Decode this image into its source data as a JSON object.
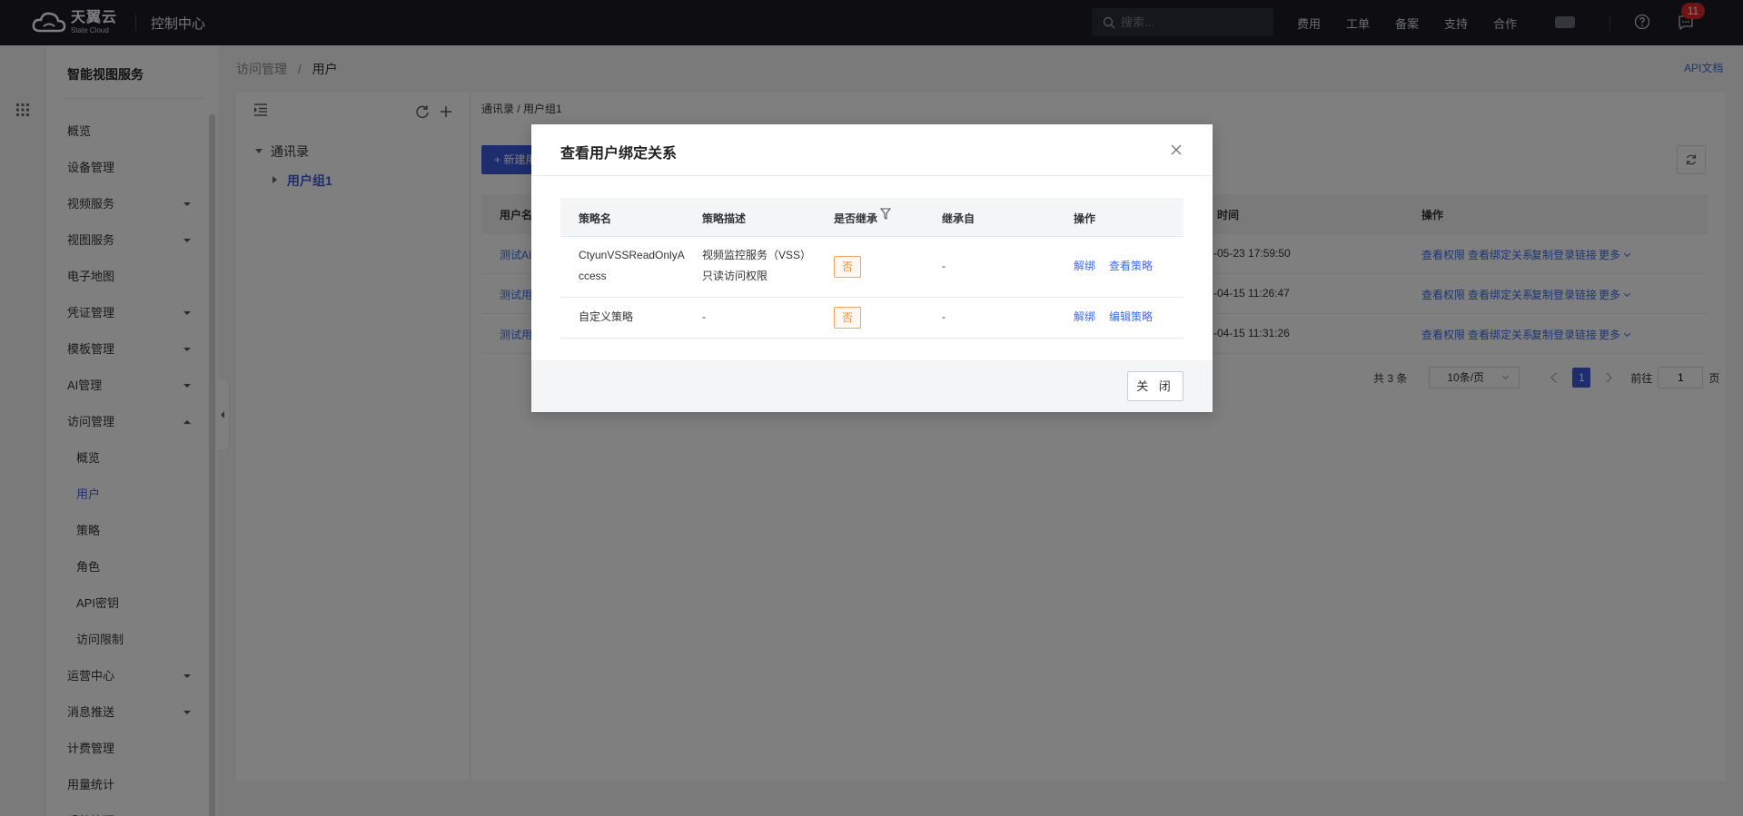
{
  "topbar": {
    "brand_cn": "天翼云",
    "brand_en": "State Cloud",
    "console": "控制中心",
    "search_placeholder": "搜索...",
    "nav": [
      "费用",
      "工单",
      "备案",
      "支持",
      "合作"
    ],
    "message_count": "11"
  },
  "sidebar": {
    "title": "智能视图服务",
    "items": [
      {
        "label": "概览",
        "sub": false,
        "caret": "none",
        "active": false
      },
      {
        "label": "设备管理",
        "sub": false,
        "caret": "none",
        "active": false
      },
      {
        "label": "视频服务",
        "sub": false,
        "caret": "down",
        "active": false
      },
      {
        "label": "视图服务",
        "sub": false,
        "caret": "down",
        "active": false
      },
      {
        "label": "电子地图",
        "sub": false,
        "caret": "none",
        "active": false
      },
      {
        "label": "凭证管理",
        "sub": false,
        "caret": "down",
        "active": false
      },
      {
        "label": "模板管理",
        "sub": false,
        "caret": "down",
        "active": false
      },
      {
        "label": "AI管理",
        "sub": false,
        "caret": "down",
        "active": false
      },
      {
        "label": "访问管理",
        "sub": false,
        "caret": "up",
        "active": false
      },
      {
        "label": "概览",
        "sub": true,
        "caret": "none",
        "active": false
      },
      {
        "label": "用户",
        "sub": true,
        "caret": "none",
        "active": true
      },
      {
        "label": "策略",
        "sub": true,
        "caret": "none",
        "active": false
      },
      {
        "label": "角色",
        "sub": true,
        "caret": "none",
        "active": false
      },
      {
        "label": "API密钥",
        "sub": true,
        "caret": "none",
        "active": false
      },
      {
        "label": "访问限制",
        "sub": true,
        "caret": "none",
        "active": false
      },
      {
        "label": "运营中心",
        "sub": false,
        "caret": "down",
        "active": false
      },
      {
        "label": "消息推送",
        "sub": false,
        "caret": "down",
        "active": false
      },
      {
        "label": "计费管理",
        "sub": false,
        "caret": "none",
        "active": false
      },
      {
        "label": "用量统计",
        "sub": false,
        "caret": "none",
        "active": false
      },
      {
        "label": "系统管理",
        "sub": false,
        "caret": "none",
        "active": false
      }
    ]
  },
  "breadcrumb": {
    "parent": "访问管理",
    "sep": "/",
    "current": "用户"
  },
  "api_doc": "API文档",
  "tree": {
    "root": "通讯录",
    "child": "用户组1"
  },
  "content": {
    "crumb": "通讯录 / 用户组1",
    "new_button": "+ 新建用户",
    "columns": {
      "name": "用户名",
      "time": "时间",
      "ops": "操作"
    },
    "rows": [
      {
        "name": "测试AI",
        "time": "-05-23 17:59:50"
      },
      {
        "name": "测试用",
        "time": "-04-15 11:26:47"
      },
      {
        "name": "测试用",
        "time": "-04-15 11:31:26"
      }
    ],
    "row_actions": [
      "查看权限",
      "查看绑定关系",
      "复制登录链接",
      "更多"
    ],
    "pager": {
      "total": "共 3 条",
      "page_size": "10条/页",
      "current_page": "1",
      "goto_label": "前往",
      "goto_value": "1",
      "page_unit": "页"
    }
  },
  "modal": {
    "title": "查看用户绑定关系",
    "columns": [
      "策略名",
      "策略描述",
      "是否继承",
      "继承自",
      "操作"
    ],
    "rows": [
      {
        "name_line1": "CtyunVSSReadOnlyA",
        "name_line2": "ccess",
        "desc_line1": "视频监控服务（VSS）",
        "desc_line2": "只读访问权限",
        "inherit": "否",
        "from": "-",
        "op1": "解绑",
        "op2": "查看策略"
      },
      {
        "name_line1": "自定义策略",
        "name_line2": "",
        "desc_line1": "-",
        "desc_line2": "",
        "inherit": "否",
        "from": "-",
        "op1": "解绑",
        "op2": "编辑策略"
      }
    ],
    "close_label": "关 闭"
  },
  "colors": {
    "primary": "#3b5bdb",
    "link": "#3b6de0",
    "topbar": "#1c1d24",
    "tag_orange": "#f08a2c",
    "badge": "#e02b2b"
  }
}
